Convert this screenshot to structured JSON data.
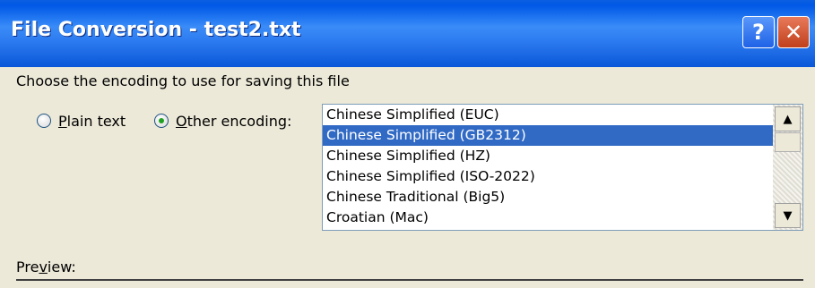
{
  "window": {
    "title": "File Conversion - test2.txt",
    "help_label": "?",
    "close_label": "✕"
  },
  "main": {
    "choose_label": "Choose the encoding to use for saving this file",
    "radios": {
      "plain_text": {
        "accel": "P",
        "rest": "lain text",
        "checked": false
      },
      "other_encoding": {
        "accel": "O",
        "rest": "ther encoding:",
        "checked": true
      }
    },
    "encoding_list": {
      "items": [
        "Chinese Simplified (EUC)",
        "Chinese Simplified (GB2312)",
        "Chinese Simplified (HZ)",
        "Chinese Simplified (ISO-2022)",
        "Chinese Traditional (Big5)",
        "Croatian (Mac)"
      ],
      "selected_index": 1
    },
    "scroll_up": "▲",
    "scroll_down": "▼",
    "preview_label": {
      "pre": "Pre",
      "accel": "v",
      "post": "iew:"
    }
  },
  "colors": {
    "selection": "#316ac5",
    "titlebar": "#0058e6",
    "dialog_bg": "#ece9d8"
  },
  "icons": {
    "help": "help-icon",
    "close": "close-icon"
  }
}
